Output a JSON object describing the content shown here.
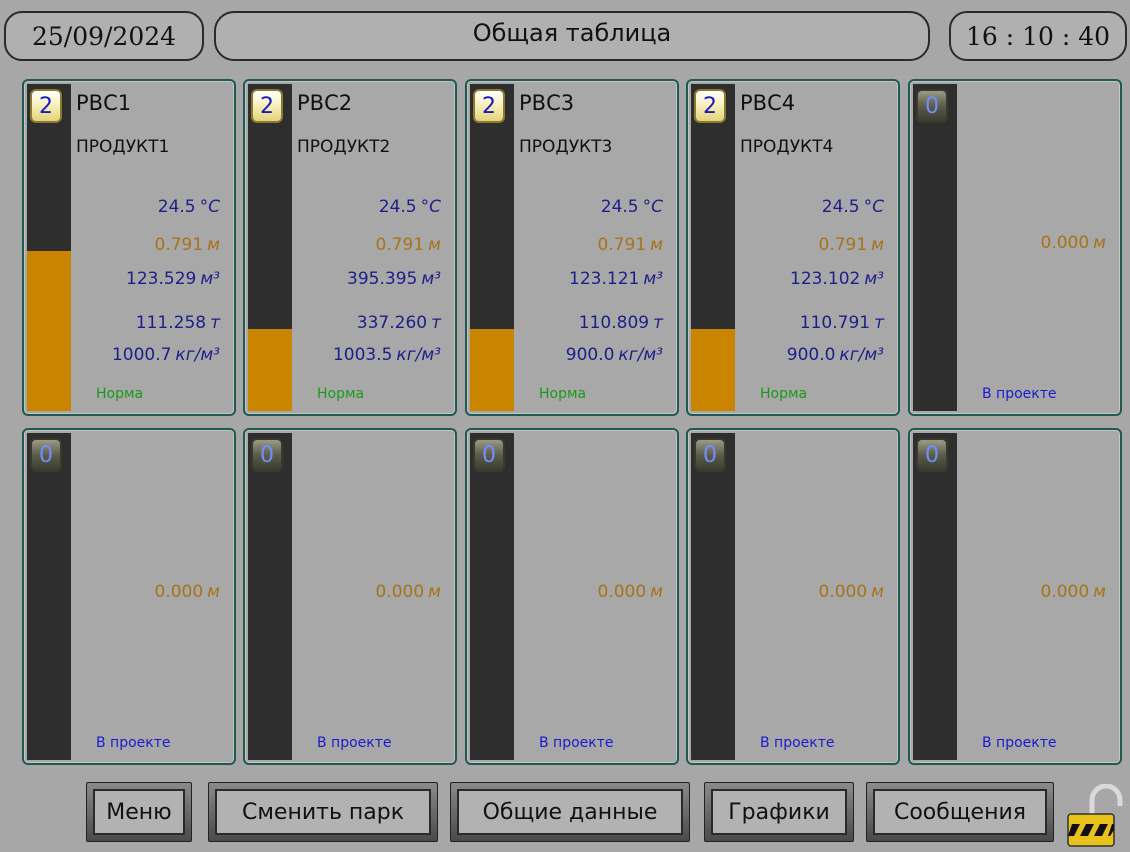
{
  "header": {
    "date": "25/09/2024",
    "title": "Общая таблица",
    "time": "16 : 10 : 40"
  },
  "tanks": [
    {
      "badge": "2",
      "name": "РВС1",
      "product": "ПРОДУКТ1",
      "temp": "24.5",
      "temp_unit": "°C",
      "level": "0.791",
      "level_unit": "м",
      "volume": "123.529",
      "volume_unit": "м³",
      "mass": "111.258",
      "mass_unit": "т",
      "density": "1000.7",
      "density_unit": "кг/м³",
      "status": "Норма",
      "fill_level": 0.49
    },
    {
      "badge": "2",
      "name": "РВС2",
      "product": "ПРОДУКТ2",
      "temp": "24.5",
      "temp_unit": "°C",
      "level": "0.791",
      "level_unit": "м",
      "volume": "395.395",
      "volume_unit": "м³",
      "mass": "337.260",
      "mass_unit": "т",
      "density": "1003.5",
      "density_unit": "кг/м³",
      "status": "Норма",
      "fill_level": 0.25
    },
    {
      "badge": "2",
      "name": "РВС3",
      "product": "ПРОДУКТ3",
      "temp": "24.5",
      "temp_unit": "°C",
      "level": "0.791",
      "level_unit": "м",
      "volume": "123.121",
      "volume_unit": "м³",
      "mass": "110.809",
      "mass_unit": "т",
      "density": "900.0",
      "density_unit": "кг/м³",
      "status": "Норма",
      "fill_level": 0.25
    },
    {
      "badge": "2",
      "name": "РВС4",
      "product": "ПРОДУКТ4",
      "temp": "24.5",
      "temp_unit": "°C",
      "level": "0.791",
      "level_unit": "м",
      "volume": "123.102",
      "volume_unit": "м³",
      "mass": "110.791",
      "mass_unit": "т",
      "density": "900.0",
      "density_unit": "кг/м³",
      "status": "Норма",
      "fill_level": 0.25
    },
    {
      "badge": "0",
      "level": "0.000",
      "level_unit": "м",
      "status": "В проекте",
      "fill_level": 0
    },
    {
      "badge": "0",
      "level": "0.000",
      "level_unit": "м",
      "status": "В проекте",
      "fill_level": 0
    },
    {
      "badge": "0",
      "level": "0.000",
      "level_unit": "м",
      "status": "В проекте",
      "fill_level": 0
    },
    {
      "badge": "0",
      "level": "0.000",
      "level_unit": "м",
      "status": "В проекте",
      "fill_level": 0
    },
    {
      "badge": "0",
      "level": "0.000",
      "level_unit": "м",
      "status": "В проекте",
      "fill_level": 0
    },
    {
      "badge": "0",
      "level": "0.000",
      "level_unit": "м",
      "status": "В проекте",
      "fill_level": 0
    }
  ],
  "buttons": {
    "menu": "Меню",
    "change_park": "Сменить парк",
    "general_data": "Общие данные",
    "graphs": "Графики",
    "messages": "Сообщения"
  },
  "colors": {
    "fill": "#c98500",
    "ok_status": "#1a9a1a",
    "project_status": "#1a1ad0"
  },
  "icons": {
    "lock": "lock-open-icon"
  }
}
